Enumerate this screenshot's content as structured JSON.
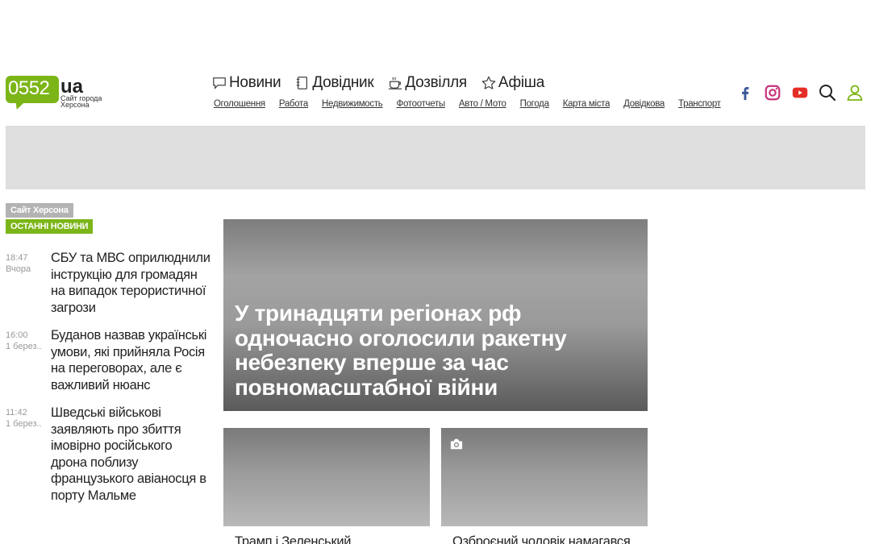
{
  "header": {
    "logo": {
      "number": "0552",
      "suffix": "ua",
      "tagline": "Сайт города Херсона"
    },
    "main_nav": [
      {
        "label": "Новини",
        "icon": "chat-icon"
      },
      {
        "label": "Довідник",
        "icon": "notebook-icon"
      },
      {
        "label": "Дозвілля",
        "icon": "coffee-icon"
      },
      {
        "label": "Афіша",
        "icon": "star-icon"
      }
    ],
    "sub_nav": [
      "Оголошення",
      "Работа",
      "Недвижимость",
      "Фотоотчеты",
      "Авто / Мото",
      "Погода",
      "Карта міста",
      "Довідкова",
      "Транспорт"
    ],
    "icons": [
      "facebook-icon",
      "instagram-icon",
      "youtube-icon",
      "search-icon",
      "user-icon"
    ]
  },
  "colors": {
    "brand": "#7cb518",
    "tag_gray": "#b3b3b3",
    "banner": "#dedede"
  },
  "feed": {
    "tag_site": "Сайт Херсона",
    "tag_latest": "ОСТАННІ НОВИНИ",
    "items": [
      {
        "time": "18:47",
        "date": "Вчора",
        "title": "СБУ та МВС оприлюднили інструкцію для громадян на випадок терористичної загрози"
      },
      {
        "time": "16:00",
        "date": "1 берез...",
        "title": "Буданов назвав українські умови, які прийняла Росія на переговорах, але є важливий нюанс"
      },
      {
        "time": "11:42",
        "date": "1 берез...",
        "title": "Шведські військові заявляють про збиття імовірно російського дрона поблизу французького авіаносця в порту Мальме"
      }
    ]
  },
  "hero": {
    "title": "У тринадцяти регіонах рф одночасно оголосили ракетну небезпеку вперше за час повномасштабної війни"
  },
  "cards": [
    {
      "title": "Трамп і Зеленський"
    },
    {
      "title": "Озброєний чоловік намагався"
    }
  ]
}
